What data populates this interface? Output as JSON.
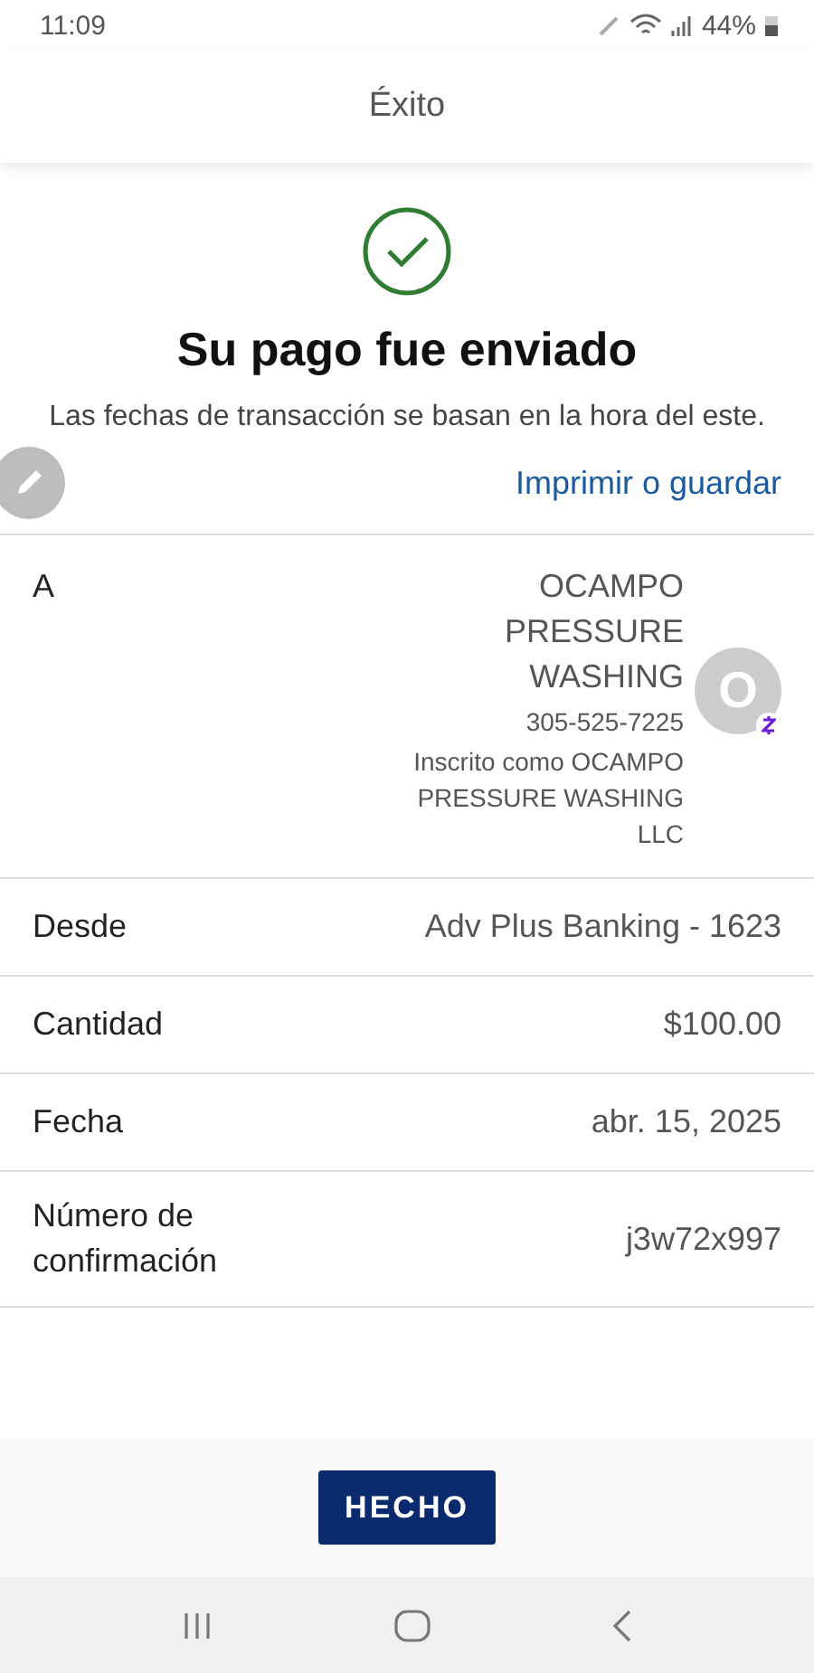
{
  "status_bar": {
    "time": "11:09",
    "battery": "44%"
  },
  "header": {
    "title": "Éxito"
  },
  "success": {
    "title": "Su pago fue enviado",
    "note": "Las fechas de transacción se basan en la hora del este."
  },
  "print_link": "Imprimir o guardar",
  "recipient": {
    "label": "A",
    "name": "OCAMPO PRESSURE WASHING",
    "phone": "305-525-7225",
    "enrolled": "Inscrito como OCAMPO PRESSURE WASHING LLC",
    "initial": "O"
  },
  "details": [
    {
      "label": "Desde",
      "value": "Adv Plus Banking - 1623"
    },
    {
      "label": "Cantidad",
      "value": "$100.00"
    },
    {
      "label": "Fecha",
      "value": "abr. 15, 2025"
    },
    {
      "label": "Número de confirmación",
      "value": "j3w72x997"
    }
  ],
  "done_button": "HECHO"
}
